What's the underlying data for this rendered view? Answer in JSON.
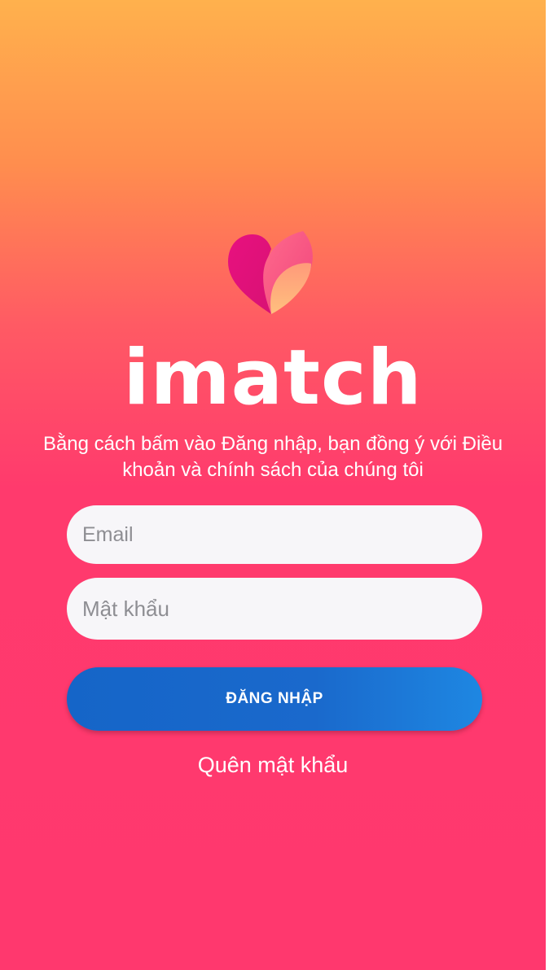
{
  "app": {
    "name": "imatch"
  },
  "terms": {
    "line1": "Bằng cách bấm vào Đăng nhập, bạn đồng ý với Điều",
    "line2": "khoản và chính sách của chúng tôi"
  },
  "form": {
    "email_placeholder": "Email",
    "email_value": "",
    "password_placeholder": "Mật khẩu",
    "password_value": "",
    "login_label": "ĐĂNG NHẬP",
    "forgot_label": "Quên mật khẩu"
  },
  "icons": {
    "logo": "heart-flame-logo-icon"
  },
  "colors": {
    "gradient_top": "#FFB14D",
    "gradient_bottom": "#FF386E",
    "button_blue": "#1565C8",
    "field_bg": "#F7F6F9"
  }
}
